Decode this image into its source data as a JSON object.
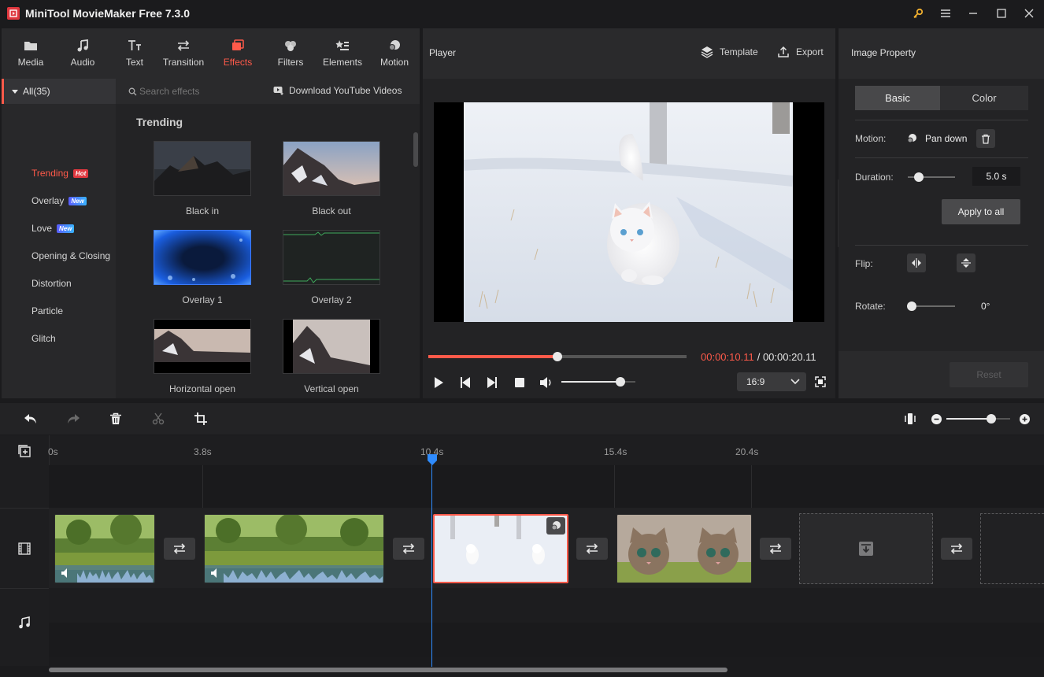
{
  "window": {
    "title": "MiniTool MovieMaker Free 7.3.0"
  },
  "tabs": [
    {
      "label": "Media",
      "icon": "folder-icon"
    },
    {
      "label": "Audio",
      "icon": "music-note-icon"
    },
    {
      "label": "Text",
      "icon": "text-icon"
    },
    {
      "label": "Transition",
      "icon": "swap-icon"
    },
    {
      "label": "Effects",
      "icon": "effects-icon",
      "active": true
    },
    {
      "label": "Filters",
      "icon": "filters-icon"
    },
    {
      "label": "Elements",
      "icon": "elements-icon"
    },
    {
      "label": "Motion",
      "icon": "motion-icon"
    }
  ],
  "categories": {
    "all": "All(35)",
    "items": [
      {
        "label": "Trending",
        "badge": "Hot"
      },
      {
        "label": "Overlay",
        "badge": "New"
      },
      {
        "label": "Love",
        "badge": "New"
      },
      {
        "label": "Opening & Closing"
      },
      {
        "label": "Distortion"
      },
      {
        "label": "Particle"
      },
      {
        "label": "Glitch"
      }
    ]
  },
  "search": {
    "placeholder": "Search effects",
    "download_label": "Download YouTube Videos"
  },
  "effects": {
    "section_title": "Trending",
    "items": [
      "Black in",
      "Black out",
      "Overlay 1",
      "Overlay 2",
      "Horizontal open",
      "Vertical open"
    ]
  },
  "player": {
    "title": "Player",
    "template_label": "Template",
    "export_label": "Export",
    "current_time": "00:00:10.11",
    "total_time": "/ 00:00:20.11",
    "aspect_ratio": "16:9",
    "progress_fraction": 0.5,
    "volume_fraction": 0.8
  },
  "property": {
    "title": "Image Property",
    "tabs": [
      "Basic",
      "Color"
    ],
    "motion_label": "Motion:",
    "motion_value": "Pan down",
    "duration_label": "Duration:",
    "duration_value": "5.0 s",
    "apply_all_label": "Apply to all",
    "flip_label": "Flip:",
    "rotate_label": "Rotate:",
    "rotate_value": "0°",
    "reset_label": "Reset"
  },
  "timeline": {
    "ticks": [
      "0s",
      "3.8s",
      "10.4s",
      "15.4s",
      "20.4s"
    ],
    "zoom_fraction": 0.7
  },
  "colors": {
    "accent": "#ff5a4a",
    "playhead": "#2f8cff",
    "bg": "#1b1b1d",
    "panel": "#232325"
  }
}
